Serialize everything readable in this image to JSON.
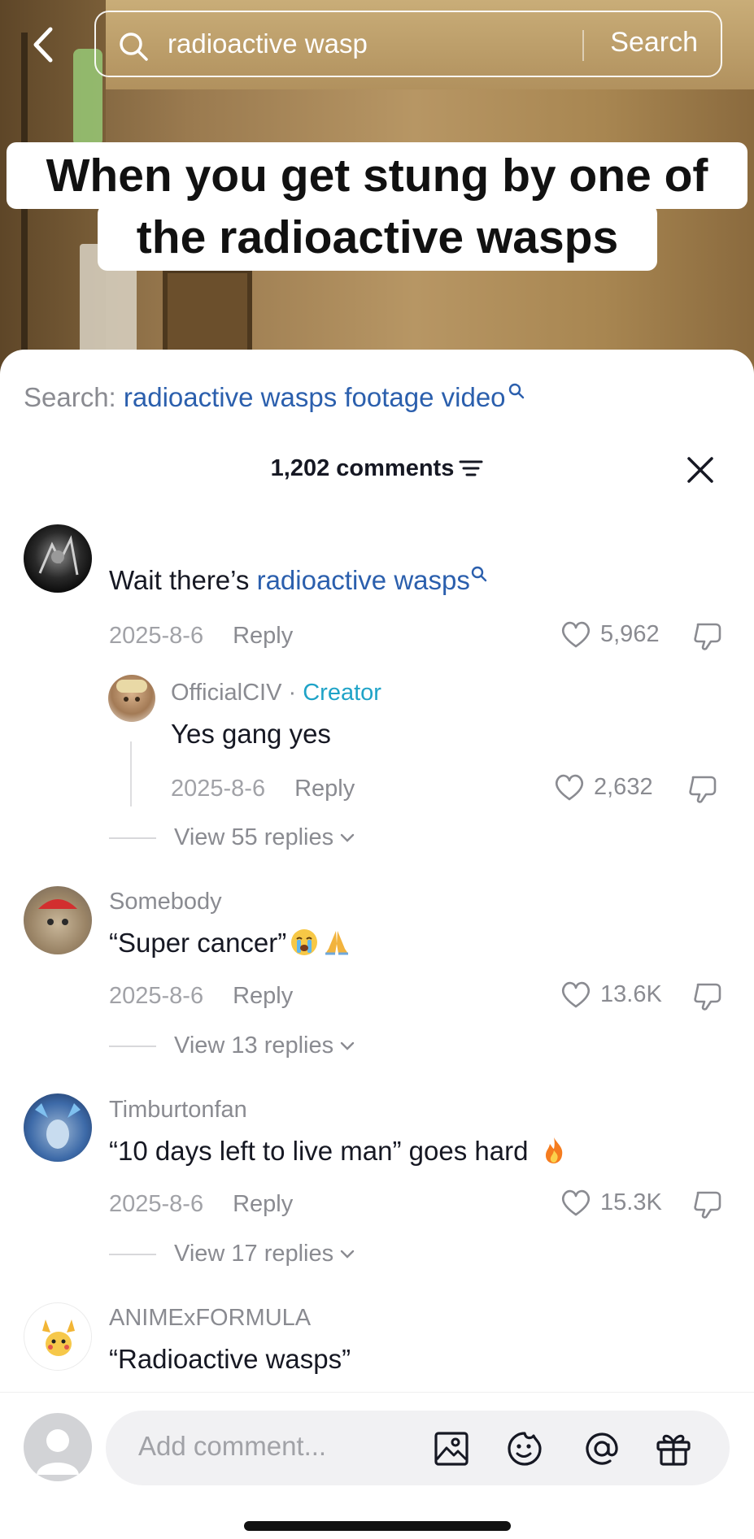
{
  "search": {
    "query": "radioactive wasp",
    "button_label": "Search"
  },
  "video": {
    "caption_line1": "When you get stung by one of",
    "caption_line2": "the radioactive wasps"
  },
  "sheet": {
    "suggest_prefix": "Search: ",
    "suggest_term": "radioactive wasps footage video",
    "comments_count": "1,202 comments"
  },
  "comments": [
    {
      "user": "",
      "text_plain": "Wait there’s ",
      "text_link": "radioactive wasps",
      "date": "2025-8-6",
      "reply_label": "Reply",
      "likes": "5,962"
    },
    {
      "user": "OfficialCIV",
      "badge_sep": " · ",
      "badge": "Creator",
      "text": "Yes gang yes",
      "date": "2025-8-6",
      "reply_label": "Reply",
      "likes": "2,632",
      "view_replies": "View 55 replies"
    },
    {
      "user": "Somebody",
      "text": "“Super cancer”",
      "date": "2025-8-6",
      "reply_label": "Reply",
      "likes": "13.6K",
      "view_replies": "View 13 replies"
    },
    {
      "user": "Timburtonfan",
      "text": "“10 days left to live man” goes hard",
      "date": "2025-8-6",
      "reply_label": "Reply",
      "likes": "15.3K",
      "view_replies": "View 17 replies"
    },
    {
      "user": "ANIMExFORMULA",
      "text": "“Radioactive wasps”"
    }
  ],
  "composer": {
    "placeholder": "Add comment..."
  },
  "icons": [
    "back-arrow-icon",
    "search-icon",
    "sort-icon",
    "close-icon",
    "heart-icon",
    "dislike-icon",
    "chevron-down-icon",
    "image-icon",
    "emoji-icon",
    "mention-icon",
    "gift-icon"
  ],
  "colors": {
    "link": "#2b5fad",
    "creator": "#1fa3c7",
    "muted": "#8a8b91",
    "text": "#161823"
  }
}
